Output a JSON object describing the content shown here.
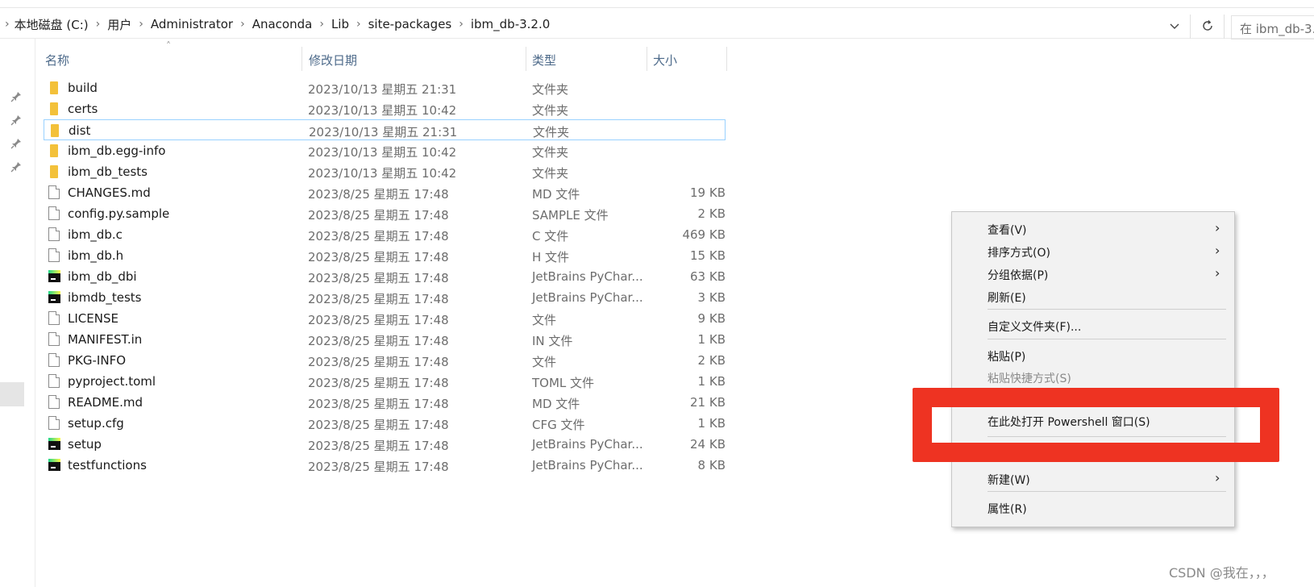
{
  "breadcrumb": {
    "items": [
      "本地磁盘 (C:)",
      "用户",
      "Administrator",
      "Anaconda",
      "Lib",
      "site-packages",
      "ibm_db-3.2.0"
    ]
  },
  "search": {
    "placeholder": "在 ibm_db-3."
  },
  "columns": {
    "name": "名称",
    "modified": "修改日期",
    "type": "类型",
    "size": "大小"
  },
  "files": [
    {
      "name": "build",
      "date": "2023/10/13 星期五 21:31",
      "type": "文件夹",
      "size": "",
      "icon": "folder-icon"
    },
    {
      "name": "certs",
      "date": "2023/10/13 星期五 10:42",
      "type": "文件夹",
      "size": "",
      "icon": "folder-icon"
    },
    {
      "name": "dist",
      "date": "2023/10/13 星期五 21:31",
      "type": "文件夹",
      "size": "",
      "icon": "folder-icon"
    },
    {
      "name": "ibm_db.egg-info",
      "date": "2023/10/13 星期五 10:42",
      "type": "文件夹",
      "size": "",
      "icon": "folder-icon"
    },
    {
      "name": "ibm_db_tests",
      "date": "2023/10/13 星期五 10:42",
      "type": "文件夹",
      "size": "",
      "icon": "folder-icon"
    },
    {
      "name": "CHANGES.md",
      "date": "2023/8/25 星期五 17:48",
      "type": "MD 文件",
      "size": "19 KB",
      "icon": "file-icon"
    },
    {
      "name": "config.py.sample",
      "date": "2023/8/25 星期五 17:48",
      "type": "SAMPLE 文件",
      "size": "2 KB",
      "icon": "file-icon"
    },
    {
      "name": "ibm_db.c",
      "date": "2023/8/25 星期五 17:48",
      "type": "C 文件",
      "size": "469 KB",
      "icon": "file-icon"
    },
    {
      "name": "ibm_db.h",
      "date": "2023/8/25 星期五 17:48",
      "type": "H 文件",
      "size": "15 KB",
      "icon": "file-icon"
    },
    {
      "name": "ibm_db_dbi",
      "date": "2023/8/25 星期五 17:48",
      "type": "JetBrains PyChar...",
      "size": "63 KB",
      "icon": "pycharm-icon"
    },
    {
      "name": "ibmdb_tests",
      "date": "2023/8/25 星期五 17:48",
      "type": "JetBrains PyChar...",
      "size": "3 KB",
      "icon": "pycharm-icon"
    },
    {
      "name": "LICENSE",
      "date": "2023/8/25 星期五 17:48",
      "type": "文件",
      "size": "9 KB",
      "icon": "file-icon"
    },
    {
      "name": "MANIFEST.in",
      "date": "2023/8/25 星期五 17:48",
      "type": "IN 文件",
      "size": "1 KB",
      "icon": "file-icon"
    },
    {
      "name": "PKG-INFO",
      "date": "2023/8/25 星期五 17:48",
      "type": "文件",
      "size": "2 KB",
      "icon": "file-icon"
    },
    {
      "name": "pyproject.toml",
      "date": "2023/8/25 星期五 17:48",
      "type": "TOML 文件",
      "size": "1 KB",
      "icon": "file-icon"
    },
    {
      "name": "README.md",
      "date": "2023/8/25 星期五 17:48",
      "type": "MD 文件",
      "size": "21 KB",
      "icon": "file-icon"
    },
    {
      "name": "setup.cfg",
      "date": "2023/8/25 星期五 17:48",
      "type": "CFG 文件",
      "size": "1 KB",
      "icon": "file-icon"
    },
    {
      "name": "setup",
      "date": "2023/8/25 星期五 17:48",
      "type": "JetBrains PyChar...",
      "size": "24 KB",
      "icon": "pycharm-icon"
    },
    {
      "name": "testfunctions",
      "date": "2023/8/25 星期五 17:48",
      "type": "JetBrains PyChar...",
      "size": "8 KB",
      "icon": "pycharm-icon"
    }
  ],
  "selected_file": "dist",
  "context_menu": {
    "view": "查看(V)",
    "sort": "排序方式(O)",
    "group": "分组依据(P)",
    "refresh": "刷新(E)",
    "customize": "自定义文件夹(F)...",
    "paste": "粘贴(P)",
    "paste_shortcut": "粘贴快捷方式(S)",
    "powershell": "在此处打开 Powershell 窗口(S)",
    "new": "新建(W)",
    "properties": "属性(R)"
  },
  "annotation_color": "#ee3322",
  "watermark": "CSDN @我在，，，"
}
